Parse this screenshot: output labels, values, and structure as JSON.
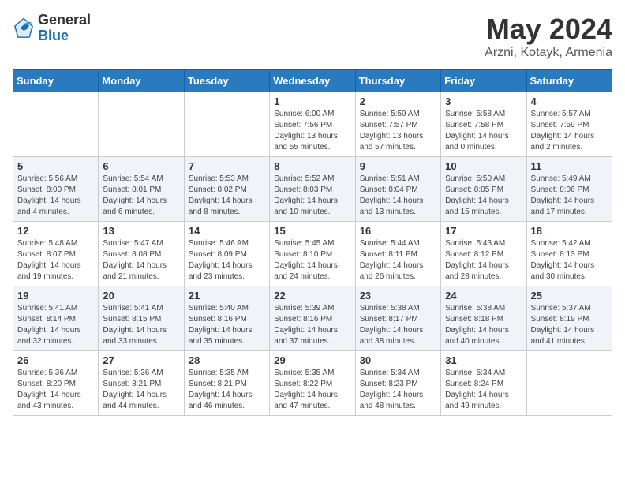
{
  "logo": {
    "general": "General",
    "blue": "Blue"
  },
  "title": {
    "month": "May 2024",
    "location": "Arzni, Kotayk, Armenia"
  },
  "days_of_week": [
    "Sunday",
    "Monday",
    "Tuesday",
    "Wednesday",
    "Thursday",
    "Friday",
    "Saturday"
  ],
  "weeks": [
    [
      {
        "day": "",
        "info": ""
      },
      {
        "day": "",
        "info": ""
      },
      {
        "day": "",
        "info": ""
      },
      {
        "day": "1",
        "info": "Sunrise: 6:00 AM\nSunset: 7:56 PM\nDaylight: 13 hours\nand 55 minutes."
      },
      {
        "day": "2",
        "info": "Sunrise: 5:59 AM\nSunset: 7:57 PM\nDaylight: 13 hours\nand 57 minutes."
      },
      {
        "day": "3",
        "info": "Sunrise: 5:58 AM\nSunset: 7:58 PM\nDaylight: 14 hours\nand 0 minutes."
      },
      {
        "day": "4",
        "info": "Sunrise: 5:57 AM\nSunset: 7:59 PM\nDaylight: 14 hours\nand 2 minutes."
      }
    ],
    [
      {
        "day": "5",
        "info": "Sunrise: 5:56 AM\nSunset: 8:00 PM\nDaylight: 14 hours\nand 4 minutes."
      },
      {
        "day": "6",
        "info": "Sunrise: 5:54 AM\nSunset: 8:01 PM\nDaylight: 14 hours\nand 6 minutes."
      },
      {
        "day": "7",
        "info": "Sunrise: 5:53 AM\nSunset: 8:02 PM\nDaylight: 14 hours\nand 8 minutes."
      },
      {
        "day": "8",
        "info": "Sunrise: 5:52 AM\nSunset: 8:03 PM\nDaylight: 14 hours\nand 10 minutes."
      },
      {
        "day": "9",
        "info": "Sunrise: 5:51 AM\nSunset: 8:04 PM\nDaylight: 14 hours\nand 13 minutes."
      },
      {
        "day": "10",
        "info": "Sunrise: 5:50 AM\nSunset: 8:05 PM\nDaylight: 14 hours\nand 15 minutes."
      },
      {
        "day": "11",
        "info": "Sunrise: 5:49 AM\nSunset: 8:06 PM\nDaylight: 14 hours\nand 17 minutes."
      }
    ],
    [
      {
        "day": "12",
        "info": "Sunrise: 5:48 AM\nSunset: 8:07 PM\nDaylight: 14 hours\nand 19 minutes."
      },
      {
        "day": "13",
        "info": "Sunrise: 5:47 AM\nSunset: 8:08 PM\nDaylight: 14 hours\nand 21 minutes."
      },
      {
        "day": "14",
        "info": "Sunrise: 5:46 AM\nSunset: 8:09 PM\nDaylight: 14 hours\nand 23 minutes."
      },
      {
        "day": "15",
        "info": "Sunrise: 5:45 AM\nSunset: 8:10 PM\nDaylight: 14 hours\nand 24 minutes."
      },
      {
        "day": "16",
        "info": "Sunrise: 5:44 AM\nSunset: 8:11 PM\nDaylight: 14 hours\nand 26 minutes."
      },
      {
        "day": "17",
        "info": "Sunrise: 5:43 AM\nSunset: 8:12 PM\nDaylight: 14 hours\nand 28 minutes."
      },
      {
        "day": "18",
        "info": "Sunrise: 5:42 AM\nSunset: 8:13 PM\nDaylight: 14 hours\nand 30 minutes."
      }
    ],
    [
      {
        "day": "19",
        "info": "Sunrise: 5:41 AM\nSunset: 8:14 PM\nDaylight: 14 hours\nand 32 minutes."
      },
      {
        "day": "20",
        "info": "Sunrise: 5:41 AM\nSunset: 8:15 PM\nDaylight: 14 hours\nand 33 minutes."
      },
      {
        "day": "21",
        "info": "Sunrise: 5:40 AM\nSunset: 8:16 PM\nDaylight: 14 hours\nand 35 minutes."
      },
      {
        "day": "22",
        "info": "Sunrise: 5:39 AM\nSunset: 8:16 PM\nDaylight: 14 hours\nand 37 minutes."
      },
      {
        "day": "23",
        "info": "Sunrise: 5:38 AM\nSunset: 8:17 PM\nDaylight: 14 hours\nand 38 minutes."
      },
      {
        "day": "24",
        "info": "Sunrise: 5:38 AM\nSunset: 8:18 PM\nDaylight: 14 hours\nand 40 minutes."
      },
      {
        "day": "25",
        "info": "Sunrise: 5:37 AM\nSunset: 8:19 PM\nDaylight: 14 hours\nand 41 minutes."
      }
    ],
    [
      {
        "day": "26",
        "info": "Sunrise: 5:36 AM\nSunset: 8:20 PM\nDaylight: 14 hours\nand 43 minutes."
      },
      {
        "day": "27",
        "info": "Sunrise: 5:36 AM\nSunset: 8:21 PM\nDaylight: 14 hours\nand 44 minutes."
      },
      {
        "day": "28",
        "info": "Sunrise: 5:35 AM\nSunset: 8:21 PM\nDaylight: 14 hours\nand 46 minutes."
      },
      {
        "day": "29",
        "info": "Sunrise: 5:35 AM\nSunset: 8:22 PM\nDaylight: 14 hours\nand 47 minutes."
      },
      {
        "day": "30",
        "info": "Sunrise: 5:34 AM\nSunset: 8:23 PM\nDaylight: 14 hours\nand 48 minutes."
      },
      {
        "day": "31",
        "info": "Sunrise: 5:34 AM\nSunset: 8:24 PM\nDaylight: 14 hours\nand 49 minutes."
      },
      {
        "day": "",
        "info": ""
      }
    ]
  ]
}
